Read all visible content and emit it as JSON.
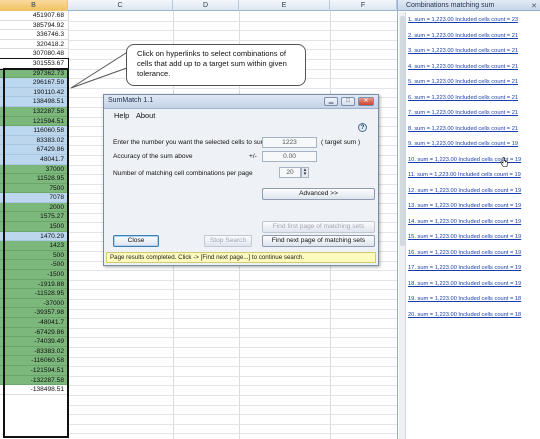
{
  "sheet": {
    "col_headers": [
      "B",
      "C",
      "D",
      "E",
      "F"
    ],
    "col_b_values": [
      "451907.68",
      "385794.92",
      "336746.3",
      "320418.2",
      "307080.48",
      "301553.67",
      "297362.73",
      "296167.59",
      "190110.42",
      "138498.51",
      "132287.58",
      "121594.51",
      "116060.58",
      "83383.02",
      "67429.86",
      "48041.7",
      "37000",
      "11528.95",
      "7500",
      "7078",
      "2000",
      "1575.27",
      "1500",
      "1470.29",
      "1423",
      "500",
      "-500",
      "-1500",
      "-1919.88",
      "-11528.95",
      "-37000",
      "-39357.98",
      "-48041.7",
      "-67429.86",
      "-74039.49",
      "-83383.02",
      "-116060.58",
      "-121594.51",
      "-132287.58",
      "-138498.51"
    ],
    "col_b_fill": [
      "w",
      "w",
      "w",
      "w",
      "w",
      "s",
      "g",
      "b",
      "b",
      "b",
      "g",
      "g",
      "b",
      "b",
      "b",
      "b",
      "g",
      "g",
      "g",
      "b",
      "g",
      "g",
      "g",
      "b",
      "g",
      "g",
      "g",
      "g",
      "g",
      "g",
      "g",
      "g",
      "g",
      "g",
      "g",
      "g",
      "g",
      "g",
      "g",
      "w"
    ]
  },
  "callout": {
    "text": "Click on hyperlinks to select combinations of cells that add up to a target sum within given tolerance."
  },
  "dialog": {
    "title": "SumMatch 1.1",
    "menu_help": "Help",
    "menu_about": "About",
    "target_label": "Enter the number you want the selected cells to sum to",
    "target_value": "1223",
    "target_suffix": "( target sum )",
    "accuracy_label": "Accuracy of the sum above",
    "plus_minus": "+/-",
    "accuracy_value": "0.00",
    "per_page_label": "Number of matching cell combinations per page",
    "per_page_value": "20",
    "advanced_label": "Advanced   >>",
    "find_first_label": "Find first page of matching sets",
    "close_label": "Close",
    "stop_label": "Stop Search",
    "find_next_label": "Find next page of matching sets",
    "status": "Page results completed. Click -> [Find next page...] to continue search."
  },
  "pane": {
    "title": "Combinations matching sum",
    "items": [
      "1. sum = 1,223.00   Included cells count = 23",
      "2. sum = 1,223.00   Included cells count = 21",
      "3. sum = 1,223.00   Included cells count = 21",
      "4. sum = 1,223.00   Included cells count = 21",
      "5. sum = 1,223.00   Included cells count = 21",
      "6. sum = 1,223.00   Included cells count = 21",
      "7. sum = 1,223.00   Included cells count = 21",
      "8. sum = 1,223.00   Included cells count = 21",
      "9. sum = 1,223.00   Included cells count = 19",
      "10. sum = 1,223.00   Included cells count = 19",
      "11. sum = 1,223.00   Included cells count = 19",
      "12. sum = 1,223.00   Included cells count = 19",
      "13. sum = 1,223.00   Included cells count = 19",
      "14. sum = 1,223.00   Included cells count = 19",
      "15. sum = 1,223.00   Included cells count = 19",
      "16. sum = 1,223.00   Included cells count = 19",
      "17. sum = 1,223.00   Included cells count = 19",
      "18. sum = 1,223.00   Included cells count = 19",
      "19. sum = 1,223.00   Included cells count = 18",
      "20. sum = 1,223.00   Included cells count = 18"
    ]
  }
}
